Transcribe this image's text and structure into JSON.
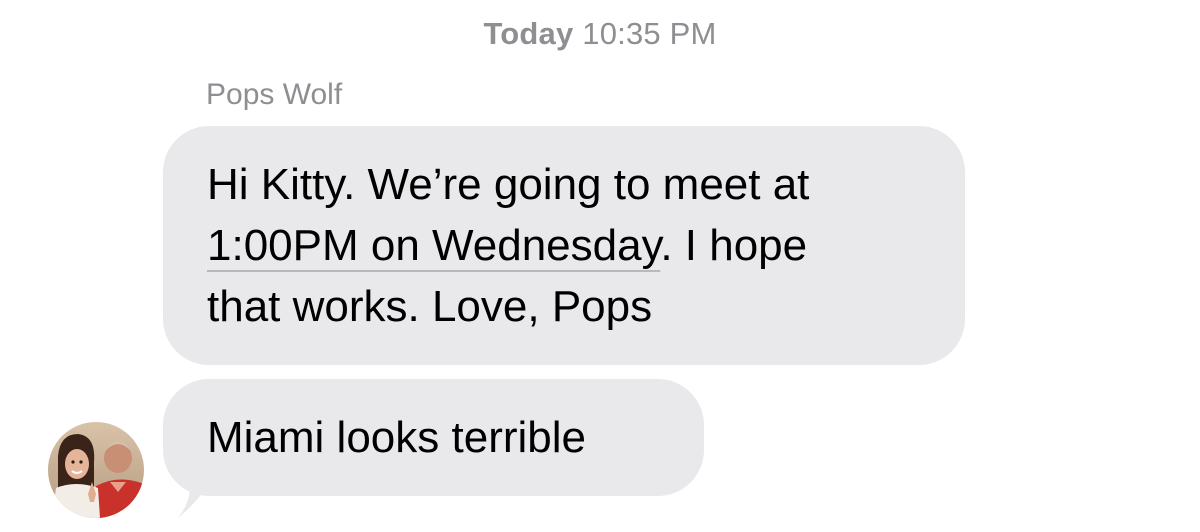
{
  "header": {
    "timestamp_day": "Today",
    "timestamp_time": "10:35 PM"
  },
  "conversation": {
    "sender_name": "Pops Wolf",
    "messages": [
      {
        "lines": [
          "Hi Kitty. We’re going to meet at",
          "1:00PM on Wednesday",
          ". I hope",
          "that works. Love, Pops"
        ],
        "detected_date_link": "1:00PM on Wednesday"
      },
      {
        "text": "Miami looks terrible"
      }
    ],
    "avatar": {
      "icon": "contact-photo-avatar"
    }
  },
  "colors": {
    "incoming_bubble": "#e9e9eb",
    "meta_text": "#8e8e93"
  }
}
